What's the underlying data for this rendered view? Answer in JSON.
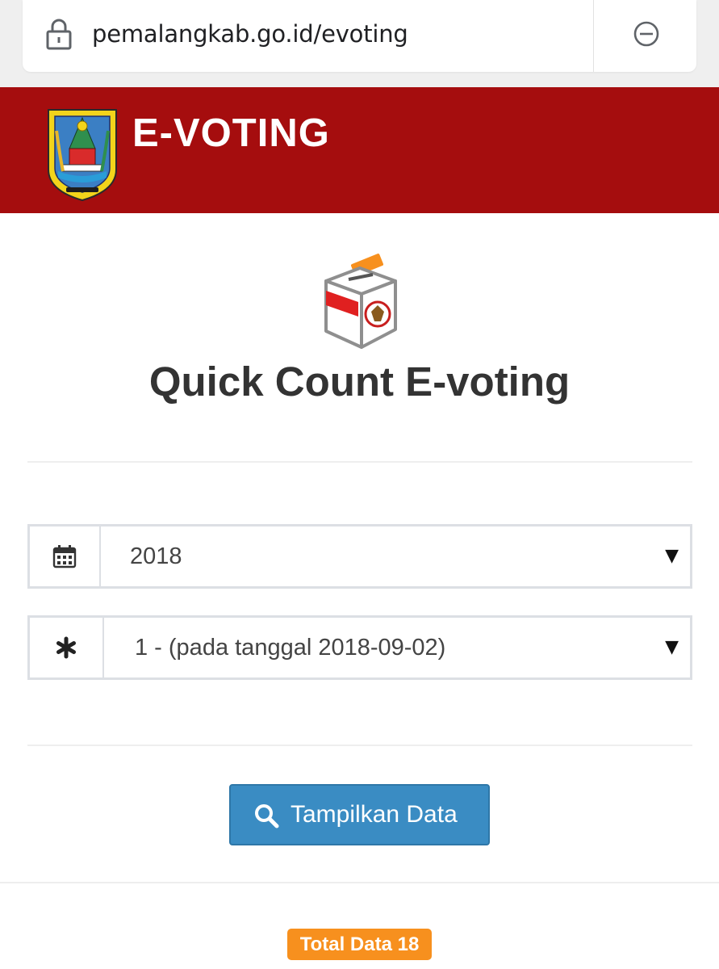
{
  "browser": {
    "url": "pemalangkab.go.id/evoting",
    "lock_icon": "lock-icon",
    "zoom_icon": "minus-circle-icon"
  },
  "header": {
    "brand": "E-VOTING",
    "emblem_icon": "regency-emblem-icon",
    "background_color": "#a50d0e"
  },
  "main": {
    "ballot_icon": "ballot-box-icon",
    "title": "Quick Count E-voting",
    "year_select": {
      "icon": "calendar-icon",
      "value": "2018"
    },
    "period_select": {
      "icon": "asterisk-icon",
      "value": "1 - (pada tanggal 2018-09-02)"
    },
    "show_button": {
      "icon": "search-icon",
      "label": "Tampilkan Data",
      "color": "#3a8cc3"
    },
    "total_badge": {
      "label": "Total Data 18",
      "color": "#f7901e"
    }
  }
}
